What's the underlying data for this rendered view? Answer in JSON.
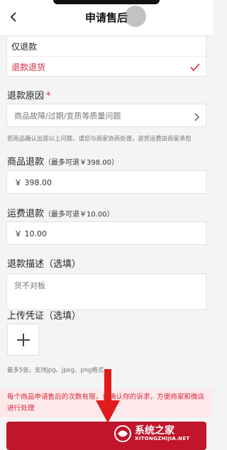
{
  "header": {
    "title": "申请售后",
    "back_icon": "chevron-left-icon"
  },
  "refund_type": {
    "options": [
      {
        "label": "仅退款",
        "selected": false
      },
      {
        "label": "退款退货",
        "selected": true
      }
    ]
  },
  "refund_reason": {
    "label": "退款原因",
    "required_mark": "*",
    "value": "商品故障/过期/变质等质量问题",
    "hint": "若商品确认出现以上问题，请您与商家协商处理，退货运费由商家承担"
  },
  "goods_refund": {
    "label": "商品退款",
    "sub": "（最多可退￥398.00）",
    "value": "￥ 398.00"
  },
  "shipping_refund": {
    "label": "运费退款",
    "sub": "（最多可退￥10.00）",
    "value": "￥ 10.00"
  },
  "refund_desc": {
    "label": "退款描述（选填）",
    "value": "货不对板"
  },
  "upload": {
    "label": "上传凭证（选填）",
    "hint": "最多5张，支持jpg、jpeg、png格式"
  },
  "notice": "每个商品申请售后的次数有限，请确认你的诉求，方便商家和微店进行处理",
  "watermark": {
    "text": "系统之家",
    "url": "XITONGZHIJIA.NET"
  },
  "colors": {
    "accent": "#d7263d",
    "submit": "#c0152a"
  }
}
